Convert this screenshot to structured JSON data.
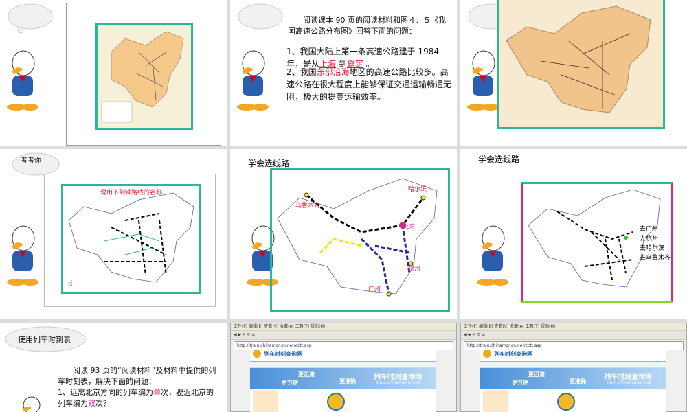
{
  "slides": {
    "s1": {
      "title": ""
    },
    "s2": {
      "intro": "阅读课本 90 页的阅读材料和图４．５《我国高速公路分布图》回答下面的问题：",
      "q1_prefix": "1、我国大陆上第一条高速公路建于 1984 年，是从",
      "q1_a1": "上海",
      "q1_mid": "到",
      "q1_a2": "嘉定",
      "q1_suffix": "。",
      "q2_prefix": "2、我国",
      "q2_a1": "东部沿海",
      "q2_suffix": "地区的高速公路比较多。高速公路在很大程度上能够保证交通运输畅通无阻，极大的提高运输效率。"
    },
    "s4": {
      "title": "考考你",
      "map_title": "说出下列铁路线的名称"
    },
    "s5": {
      "title": "学会选线路",
      "labels": [
        "哈尔滨",
        "乌鲁木齐",
        "杭州",
        "广州",
        "北京"
      ]
    },
    "s6": {
      "title": "学会选线路",
      "routes": [
        "去广州",
        "去杭州",
        "去哈尔滨",
        "去乌鲁木齐"
      ]
    },
    "s7": {
      "title": "使用列车时刻表",
      "body1": "阅读 93 页的“阅读材料”及材料中提供的列车时刻表，解决下面的问题：",
      "q1_prefix": "1、远离北京方向的列车编为",
      "q1_a": "单",
      "q1_mid": "次，驶近北京的列车编为",
      "q1_a2": "双",
      "q1_suffix": "次？"
    },
    "browser": {
      "menu": "文件(F)  编辑(E)  查看(V)  收藏(A)  工具(T)  帮助(H)",
      "address": "http://train.chinamor.cn.net/cctt.asp",
      "site_name": "列车时刻查询网",
      "site_url": "train.chinamor.cn.net",
      "banner1": "更迅速",
      "banner2": "更准确",
      "banner3": "更方便"
    }
  }
}
